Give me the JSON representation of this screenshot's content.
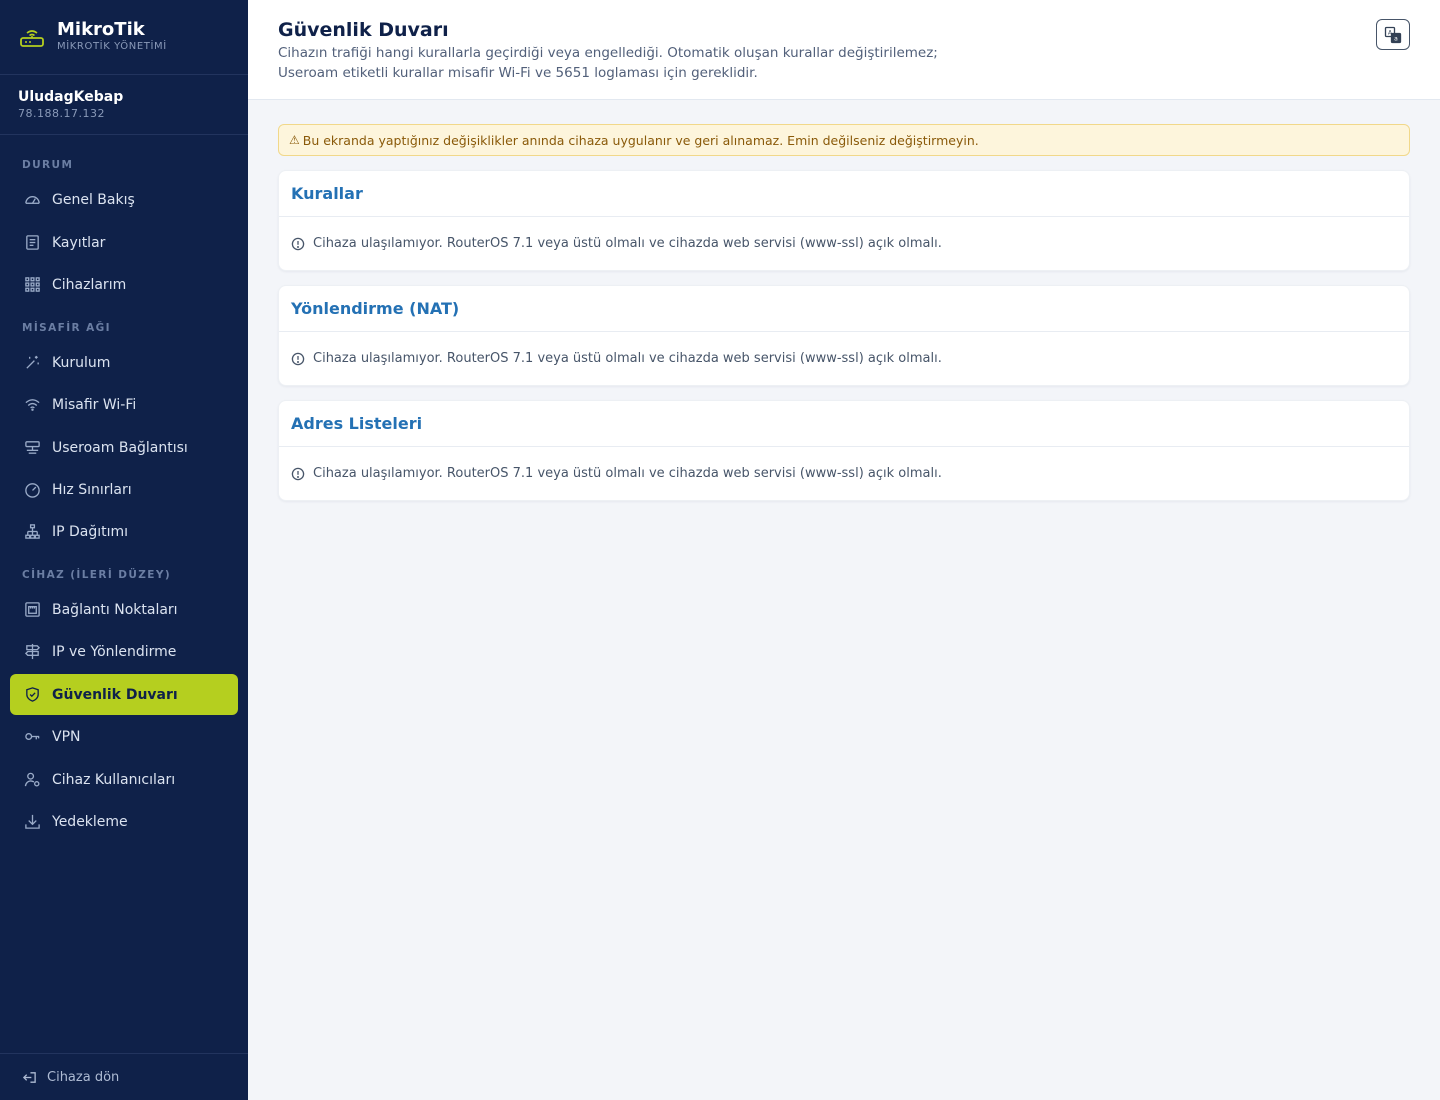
{
  "brand": {
    "name": "MikroTik",
    "subtitle": "MİKROTİK YÖNETİMİ"
  },
  "device": {
    "name": "UludagKebap",
    "ip": "78.188.17.132"
  },
  "sidebar": {
    "sections": [
      {
        "label": "DURUM"
      },
      {
        "label": "MİSAFİR AĞI"
      },
      {
        "label": "CİHAZ (İLERİ DÜZEY)"
      }
    ],
    "items": [
      {
        "label": "Genel Bakış",
        "icon": "gauge-icon"
      },
      {
        "label": "Kayıtlar",
        "icon": "log-icon"
      },
      {
        "label": "Cihazlarım",
        "icon": "grid-icon"
      },
      {
        "label": "Kurulum",
        "icon": "wand-icon"
      },
      {
        "label": "Misafir Wi-Fi",
        "icon": "wifi-icon"
      },
      {
        "label": "Useroam Bağlantısı",
        "icon": "network-icon"
      },
      {
        "label": "Hız Sınırları",
        "icon": "speedometer-icon"
      },
      {
        "label": "IP Dağıtımı",
        "icon": "tree-icon"
      },
      {
        "label": "Bağlantı Noktaları",
        "icon": "ethernet-icon"
      },
      {
        "label": "IP ve Yönlendirme",
        "icon": "signpost-icon"
      },
      {
        "label": "Güvenlik Duvarı",
        "icon": "shield-icon",
        "active": true
      },
      {
        "label": "VPN",
        "icon": "key-icon"
      },
      {
        "label": "Cihaz Kullanıcıları",
        "icon": "user-gear-icon"
      },
      {
        "label": "Yedekleme",
        "icon": "download-icon"
      }
    ],
    "footer": "Cihaza dön"
  },
  "header": {
    "title": "Güvenlik Duvarı",
    "description_line1": "Cihazın trafiği hangi kurallarla geçirdiği veya engellediği. Otomatik oluşan kurallar değiştirilemez;",
    "description_line2": "Useroam etiketli kurallar misafir Wi-Fi ve 5651 loglaması için gereklidir."
  },
  "warning": "Bu ekranda yaptığınız değişiklikler anında cihaza uygulanır ve geri alınamaz. Emin değilseniz değiştirmeyin.",
  "cards": [
    {
      "title": "Kurallar",
      "message": "Cihaza ulaşılamıyor. RouterOS 7.1 veya üstü olmalı ve cihazda web servisi (www-ssl) açık olmalı."
    },
    {
      "title": "Yönlendirme (NAT)",
      "message": "Cihaza ulaşılamıyor. RouterOS 7.1 veya üstü olmalı ve cihazda web servisi (www-ssl) açık olmalı."
    },
    {
      "title": "Adres Listeleri",
      "message": "Cihaza ulaşılamıyor. RouterOS 7.1 veya üstü olmalı ve cihazda web servisi (www-ssl) açık olmalı."
    }
  ],
  "colors": {
    "sidebar_bg": "#0f2149",
    "accent": "#b5cf1f",
    "card_title": "#2471b4",
    "warning_bg": "#fdf5dc"
  }
}
